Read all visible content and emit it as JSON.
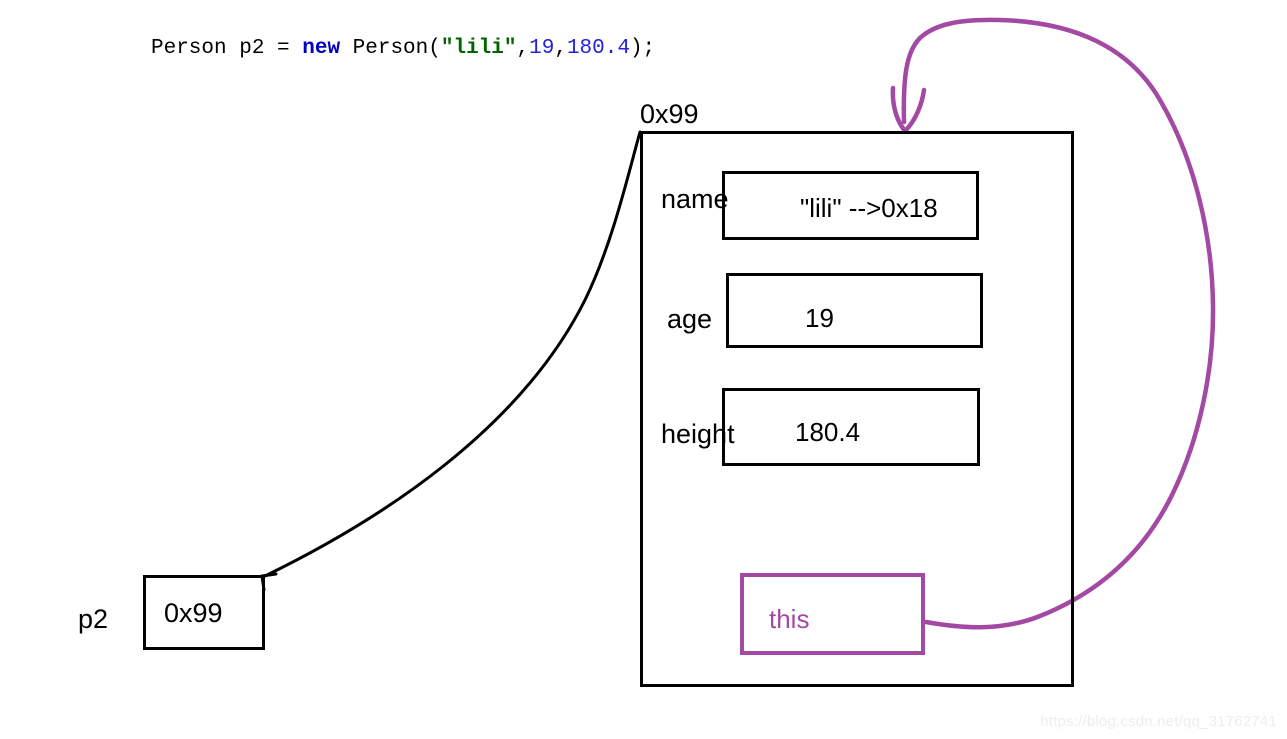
{
  "code": {
    "full_text": "Person p2 = new Person(\"lili\",19,180.4);",
    "part_before_new": "Person p2 = ",
    "keyword_new": "new",
    "part_after_new": " Person(",
    "string_arg": "\"lili\"",
    "comma1": ",",
    "num_arg1": "19",
    "comma2": ",",
    "num_arg2": "180.4",
    "tail": ");",
    "colors": {
      "keyword": "#0000c0",
      "string": "#006400",
      "number": "#2222dd",
      "plain": "#000000"
    }
  },
  "heap_object": {
    "address_label": "0x99",
    "fields": [
      {
        "label": "name",
        "value": "\"lili\" -->0x18"
      },
      {
        "label": "age",
        "value": "19"
      },
      {
        "label": "height",
        "value": "180.4"
      }
    ],
    "this_box": {
      "label": "this",
      "color": "#a349a4"
    }
  },
  "stack_variable": {
    "name": "p2",
    "value": "0x99"
  },
  "annotations": {
    "reference_arrow_color": "#000000",
    "this_arrow_color": "#a349a4"
  },
  "watermark": {
    "text": "https://blog.csdn.net/qq_31762741"
  }
}
